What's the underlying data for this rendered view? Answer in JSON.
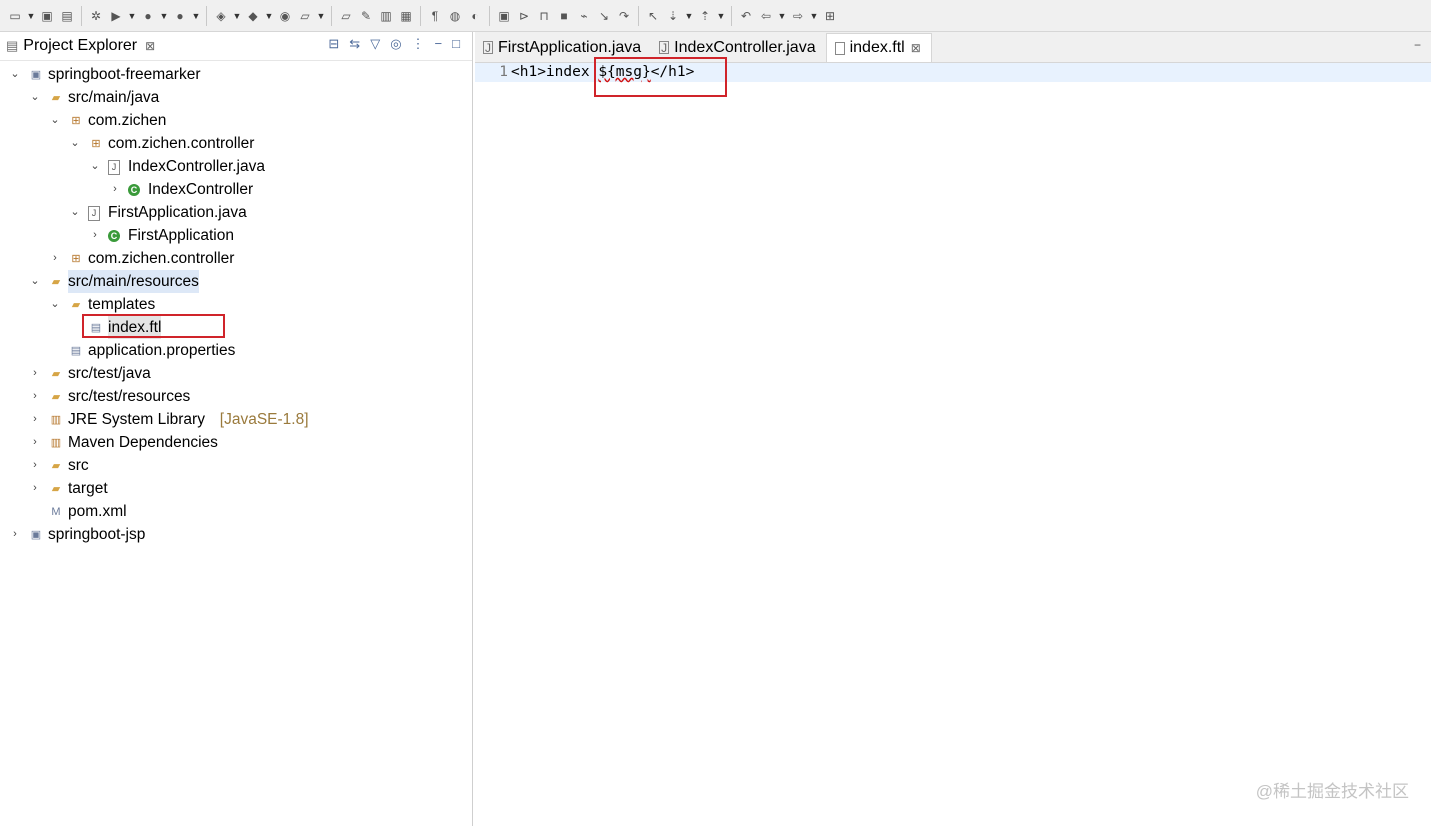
{
  "toolbar": {
    "icons": [
      "new-icon",
      "save-icon",
      "save-all-icon",
      "debug-icon",
      "run-icon",
      "run-last-icon",
      "external-tools-icon",
      "new-java-project-icon",
      "new-package-icon",
      "new-class-icon",
      "open-type-icon",
      "open-task-icon",
      "search-icon",
      "skip-breakpoints-icon",
      "build-icon",
      "show-whitespace-icon",
      "globe-icon",
      "debug-step-icon",
      "terminate-icon",
      "resume-icon",
      "suspend-icon",
      "stop-icon",
      "disconnect-icon",
      "step-into-icon",
      "step-over-icon",
      "step-return-icon",
      "next-annotation-icon",
      "prev-annotation-icon",
      "last-edit-icon",
      "back-icon",
      "forward-icon",
      "pin-editor-icon"
    ]
  },
  "project_explorer": {
    "title": "Project Explorer",
    "close": "⊠",
    "tree": [
      {
        "label": "springboot-freemarker",
        "depth": 0,
        "twisty": "v",
        "icon": "maven-project-icon"
      },
      {
        "label": "src/main/java",
        "depth": 1,
        "twisty": "v",
        "icon": "source-folder-icon"
      },
      {
        "label": "com.zichen",
        "depth": 2,
        "twisty": "v",
        "icon": "package-icon"
      },
      {
        "label": "com.zichen.controller",
        "depth": 3,
        "twisty": "v",
        "icon": "package-icon"
      },
      {
        "label": "IndexController.java",
        "depth": 4,
        "twisty": "v",
        "icon": "java-file-icon"
      },
      {
        "label": "IndexController",
        "depth": 5,
        "twisty": ">",
        "icon": "class-icon"
      },
      {
        "label": "FirstApplication.java",
        "depth": 3,
        "twisty": "v",
        "icon": "java-file-icon"
      },
      {
        "label": "FirstApplication",
        "depth": 4,
        "twisty": ">",
        "icon": "class-icon"
      },
      {
        "label": "com.zichen.controller",
        "depth": 2,
        "twisty": ">",
        "icon": "package-icon"
      },
      {
        "label": "src/main/resources",
        "depth": 1,
        "twisty": "v",
        "icon": "source-folder-icon"
      },
      {
        "label": "templates",
        "depth": 2,
        "twisty": "v",
        "icon": "folder-icon"
      },
      {
        "label": "index.ftl",
        "depth": 3,
        "twisty": "",
        "icon": "file-icon"
      },
      {
        "label": "application.properties",
        "depth": 2,
        "twisty": "",
        "icon": "file-icon"
      },
      {
        "label": "src/test/java",
        "depth": 1,
        "twisty": ">",
        "icon": "source-folder-icon"
      },
      {
        "label": "src/test/resources",
        "depth": 1,
        "twisty": ">",
        "icon": "source-folder-icon"
      },
      {
        "label": "JRE System Library",
        "decoration": "[JavaSE-1.8]",
        "depth": 1,
        "twisty": ">",
        "icon": "library-icon"
      },
      {
        "label": "Maven Dependencies",
        "depth": 1,
        "twisty": ">",
        "icon": "library-icon"
      },
      {
        "label": "src",
        "depth": 1,
        "twisty": ">",
        "icon": "folder-icon"
      },
      {
        "label": "target",
        "depth": 1,
        "twisty": ">",
        "icon": "folder-icon"
      },
      {
        "label": "pom.xml",
        "depth": 1,
        "twisty": "",
        "icon": "pom-file-icon"
      },
      {
        "label": "springboot-jsp",
        "depth": 0,
        "twisty": ">",
        "icon": "maven-project-icon"
      }
    ]
  },
  "editor": {
    "tabs": [
      {
        "label": "FirstApplication.java",
        "active": false
      },
      {
        "label": "IndexController.java",
        "active": false
      },
      {
        "label": "index.ftl",
        "active": true
      }
    ],
    "line_number": "1",
    "code_prefix": "<h1>index ",
    "code_highlight": "${msg}",
    "code_suffix": "</h1>"
  },
  "watermark": "@稀土掘金技术社区"
}
